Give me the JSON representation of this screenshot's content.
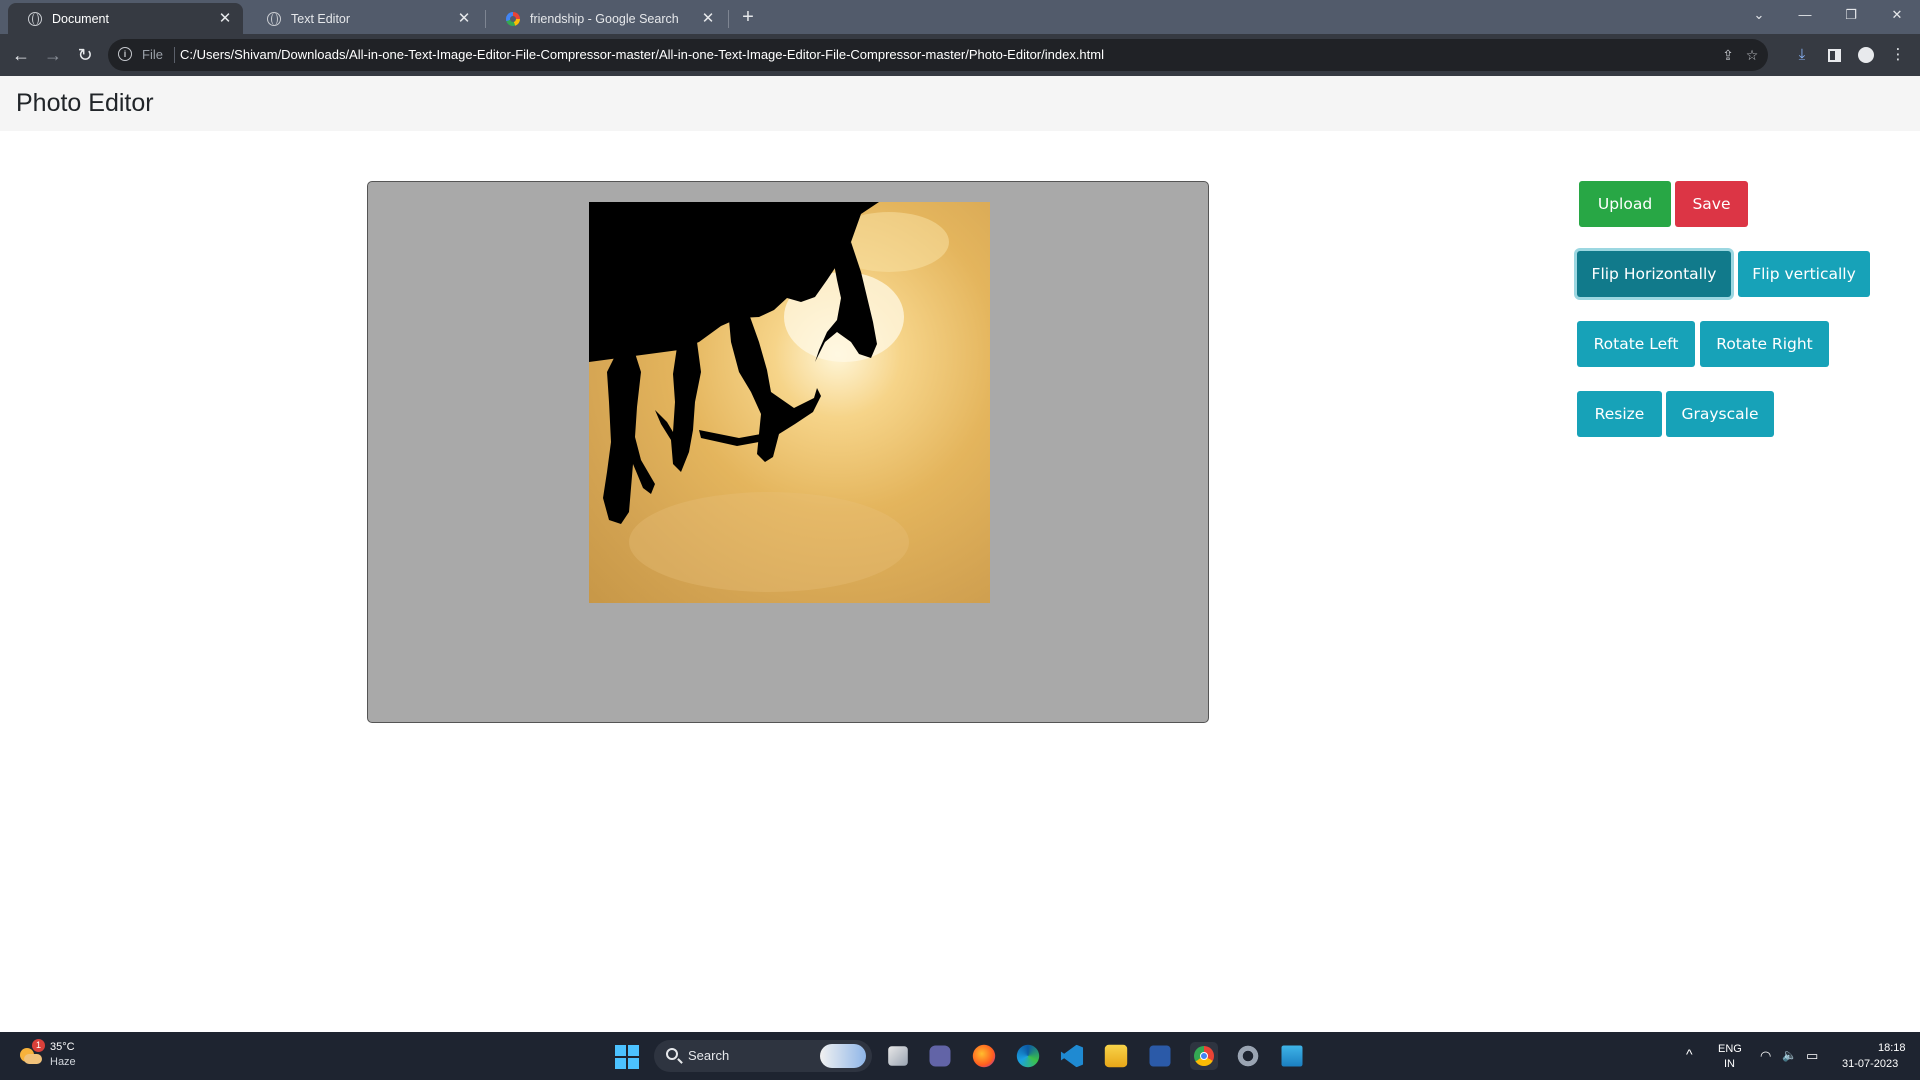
{
  "browser": {
    "tabs": [
      {
        "title": "Document",
        "active": true,
        "favicon": "globe-icon"
      },
      {
        "title": "Text Editor",
        "active": false,
        "favicon": "globe-icon"
      },
      {
        "title": "friendship - Google Search",
        "active": false,
        "favicon": "google-icon"
      }
    ],
    "tab_close_glyph": "✕",
    "new_tab_glyph": "+",
    "window_controls": {
      "tab_search": "⌄",
      "minimize": "—",
      "restore": "❐",
      "close": "✕"
    },
    "nav": {
      "back": "←",
      "forward": "→",
      "reload": "↻"
    },
    "omnibox": {
      "info_glyph": "i",
      "scheme_label": "File",
      "url": "C:/Users/Shivam/Downloads/All-in-one-Text-Image-Editor-File-Compressor-master/All-in-one-Text-Image-Editor-File-Compressor-master/Photo-Editor/index.html",
      "share_glyph": "⇪",
      "bookmark_glyph": "☆"
    },
    "toolbar_icons": {
      "download": "⤓",
      "side_panel": "",
      "profile": "",
      "menu": "⋮"
    }
  },
  "app": {
    "title": "Photo Editor",
    "buttons": {
      "upload": "Upload",
      "save": "Save",
      "flip_horizontal": "Flip Horizontally",
      "flip_vertical": "Flip vertically",
      "rotate_left": "Rotate Left",
      "rotate_right": "Rotate Right",
      "resize": "Resize",
      "grayscale": "Grayscale"
    },
    "colors": {
      "success": "#28a745",
      "danger": "#dc3545",
      "info": "#17a2b8",
      "info_pressed": "#117a8b",
      "canvas_bg": "#a9a9a9"
    },
    "image": {
      "subject": "silhouettes of friends against a golden sunset sky, flipped vertically"
    }
  },
  "taskbar": {
    "weather": {
      "temp": "35°C",
      "desc": "Haze",
      "badge": "1"
    },
    "search_placeholder": "Search",
    "apps": [
      "task-view",
      "teams-chat",
      "firefox",
      "edge",
      "vscode",
      "file-explorer",
      "powershell",
      "chrome",
      "settings",
      "notepad"
    ],
    "tray": {
      "chevron": "^",
      "lang_top": "ENG",
      "lang_bottom": "IN",
      "wifi_glyph": "◠",
      "volume_glyph": "🔈",
      "battery_glyph": "▭",
      "time": "18:18",
      "date": "31-07-2023"
    }
  }
}
